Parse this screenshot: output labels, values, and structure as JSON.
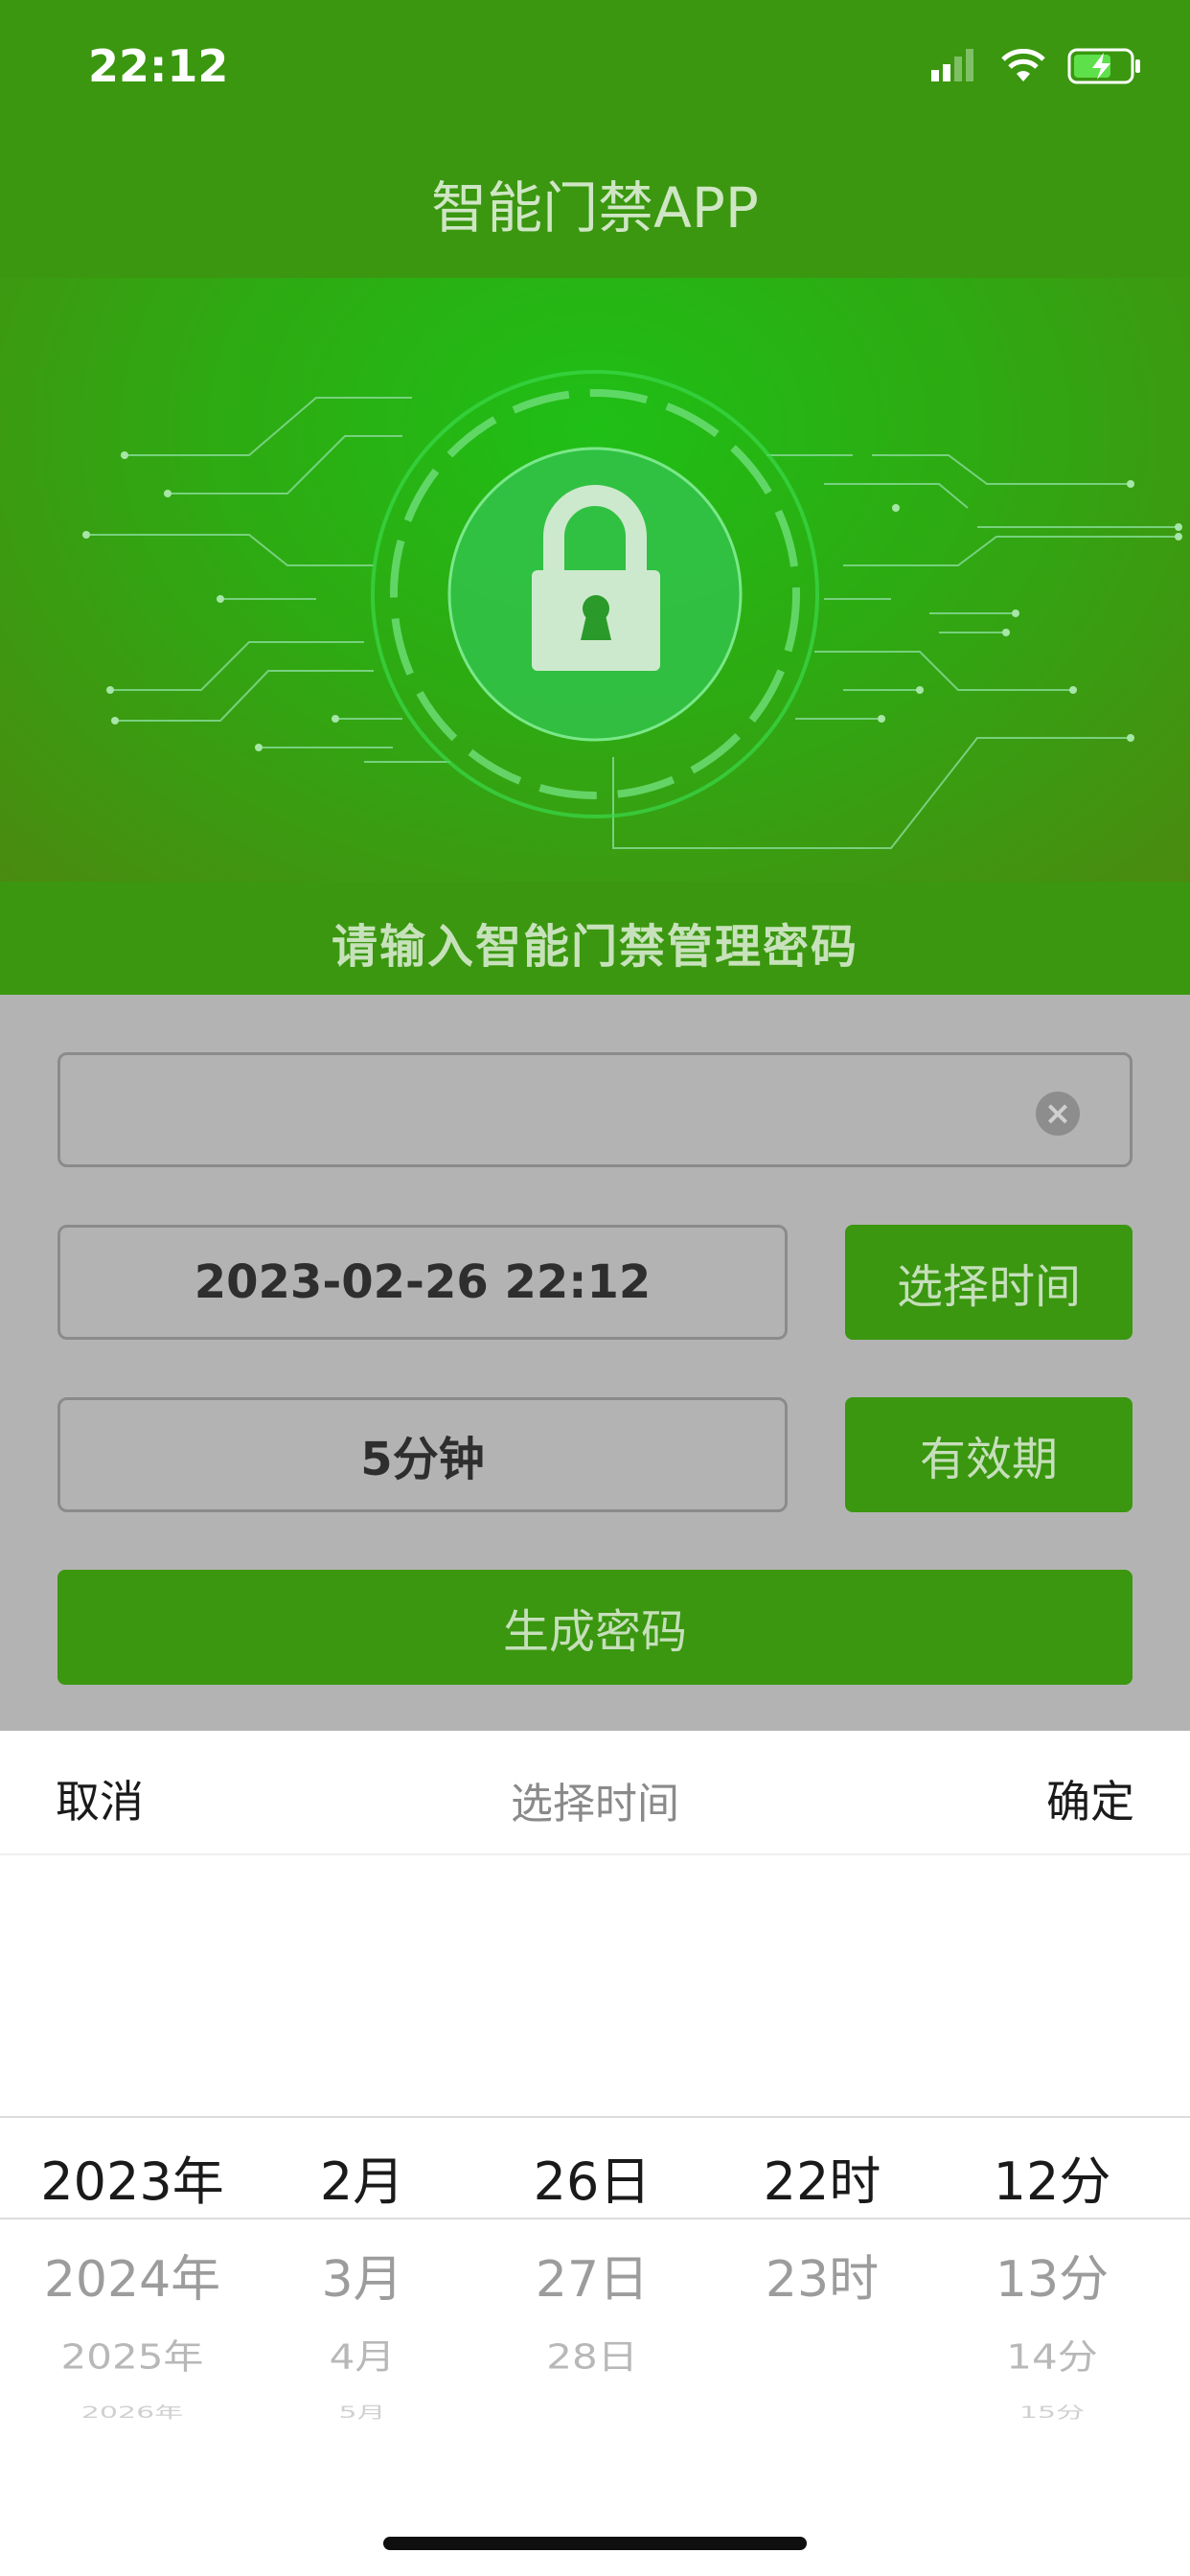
{
  "status_bar": {
    "time": "22:12"
  },
  "app": {
    "title": "智能门禁APP"
  },
  "hero": {
    "caption": "请输入智能门禁管理密码"
  },
  "form": {
    "password_value": "",
    "datetime_value": "2023-02-26 22:12",
    "choose_time_label": "选择时间",
    "validity_value": "5分钟",
    "validity_label": "有效期",
    "generate_label": "生成密码"
  },
  "sheet": {
    "cancel_label": "取消",
    "title": "选择时间",
    "confirm_label": "确定"
  },
  "picker": {
    "columns": [
      {
        "items": [
          "2023年",
          "2024年",
          "2025年",
          "2026年"
        ]
      },
      {
        "items": [
          "2月",
          "3月",
          "4月",
          "5月"
        ]
      },
      {
        "items": [
          "26日",
          "27日",
          "28日",
          ""
        ]
      },
      {
        "items": [
          "22时",
          "23时",
          "",
          ""
        ]
      },
      {
        "items": [
          "12分",
          "13分",
          "14分",
          "15分"
        ]
      }
    ]
  },
  "colors": {
    "brand_green": "#3a970f",
    "overlay_grey": "#b3b3b3"
  }
}
